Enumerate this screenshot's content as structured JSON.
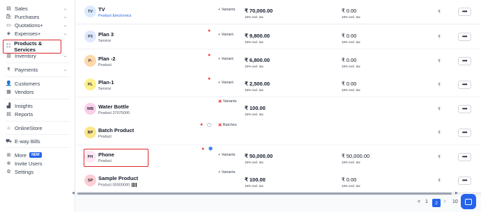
{
  "sidebar": {
    "items": [
      {
        "label": "Sales",
        "icon": "sales-icon"
      },
      {
        "label": "Purchases",
        "icon": "purchases-icon"
      },
      {
        "label": "Quotations+",
        "icon": "quotations-icon"
      },
      {
        "label": "Expenses+",
        "icon": "expenses-icon"
      },
      {
        "label": "Products & Services",
        "icon": "products-icon"
      },
      {
        "label": "Inventory",
        "icon": "inventory-icon"
      },
      {
        "label": "Payments",
        "icon": "rupee-icon"
      },
      {
        "label": "Customers",
        "icon": "customers-icon"
      },
      {
        "label": "Vendors",
        "icon": "vendors-icon"
      },
      {
        "label": "Insights",
        "icon": "insights-icon"
      },
      {
        "label": "Reports",
        "icon": "reports-icon"
      },
      {
        "label": "OnlineStore",
        "icon": "store-icon"
      },
      {
        "label": "E-way Bills",
        "icon": "truck-icon"
      },
      {
        "label": "More",
        "icon": "more-icon",
        "badge": "NEW"
      },
      {
        "label": "Invite Users",
        "icon": "invite-icon"
      },
      {
        "label": "Settings",
        "icon": "settings-icon"
      }
    ]
  },
  "products": [
    {
      "initials": "TV",
      "name": "TV",
      "sub": "Product Electronics",
      "variants": "+ Variants",
      "price": "₹ 70,000.00",
      "tax": "18% excl. tax",
      "price2": "₹ 0.00",
      "tax2": "18% excl. tax",
      "color": "#dbeafe"
    },
    {
      "initials": "P3",
      "name": "Plan 3",
      "sub": "Service",
      "variants": "+ Variant",
      "price": "₹ 9,800.00",
      "tax": "18% excl. tax",
      "price2": "₹ 0.00",
      "tax2": "18% excl. tax",
      "color": "#e0e7ff"
    },
    {
      "initials": "P-",
      "name": "Plan -2",
      "sub": "Product",
      "variants": "+ Variant",
      "price": "₹ 6,800.00",
      "tax": "18% excl. tax",
      "price2": "₹ 0.00",
      "tax2": "18% excl. tax",
      "color": "#fed7aa"
    },
    {
      "initials": "PL",
      "name": "Plan-1",
      "sub": "Service",
      "variants": "+ Variant",
      "price": "₹ 2,500.00",
      "tax": "18% excl. tax",
      "price2": "₹ 0.00",
      "tax2": "18% excl. tax",
      "color": "#fef08a"
    },
    {
      "initials": "WB",
      "name": "Water Bottle",
      "sub": "Product 27075000",
      "variants": "Variants",
      "price": "₹ 100.00",
      "tax": "18% excl. tax",
      "price2": "",
      "tax2": "",
      "color": "#fbcfe8"
    },
    {
      "initials": "BP",
      "name": "Batch Product",
      "sub": "Product",
      "variants": "Batches",
      "price": "",
      "tax": "",
      "price2": "",
      "tax2": "",
      "color": "#fde68a"
    },
    {
      "initials": "PH",
      "name": "Phone",
      "sub": "Product",
      "variants": "+ Variants",
      "price": "₹ 50,000.00",
      "tax": "18% excl. tax",
      "price2": "₹ 50,000.00",
      "tax2": "18% excl. tax",
      "color": "#fce7f3"
    },
    {
      "initials": "SP",
      "name": "Sample Product",
      "sub": "Product 00000000",
      "variants": "+ Variants",
      "price": "₹ 100.00",
      "tax": "18% excl. tax",
      "price2": "₹ 0.00",
      "tax2": "18% excl. tax",
      "color": "#fecdd3"
    }
  ],
  "more_symbol": "•••",
  "column_c_glyph": "₹",
  "pagination": {
    "prev": "<",
    "first": "1",
    "current": "2",
    "next": ">",
    "last": "10"
  }
}
